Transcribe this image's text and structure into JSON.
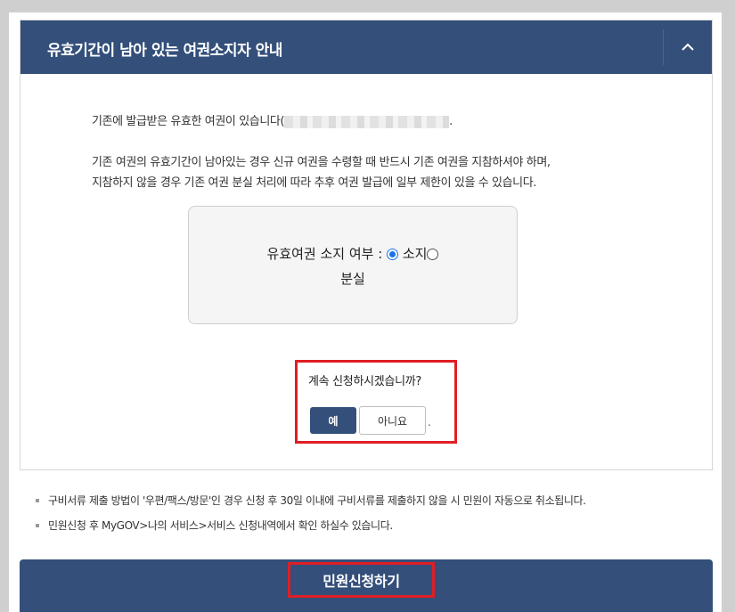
{
  "panel": {
    "title": "유효기간이 남아 있는 여권소지자 안내",
    "collapse_icon": "chevron-up-icon"
  },
  "intro": {
    "text": "기존에 발급받은 유효한 여권이 있습니다(",
    "suffix": "."
  },
  "note": {
    "line1": "기존 여권의 유효기간이 남아있는 경우 신규 여권을 수령할 때 반드시 기존 여권을 지참하셔야 하며,",
    "line2": "지참하지 않을 경우 기존 여권 분실 처리에 따라 추후 여권 발급에 일부 제한이 있을 수 있습니다."
  },
  "status": {
    "label": "유효여권 소지 여부 :",
    "option_own": "소지",
    "option_lost": "분실",
    "selected": "소지"
  },
  "confirm": {
    "question": "계속 신청하시겠습니까?",
    "yes": "예",
    "no": "아니요",
    "mark": "."
  },
  "bullets": [
    "구비서류 제출 방법이 '우편/팩스/방문'인 경우 신청 후 30일 이내에 구비서류를 제출하지 않을 시 민원이 자동으로 취소됩니다.",
    "민원신청 후 MyGOV>나의 서비스>서비스 신청내역에서 확인 하실수 있습니다."
  ],
  "submit": {
    "label": "민원신청하기"
  },
  "colors": {
    "header": "#334f7a",
    "highlight": "#e01e24",
    "radio_accent": "#1a73e8"
  }
}
